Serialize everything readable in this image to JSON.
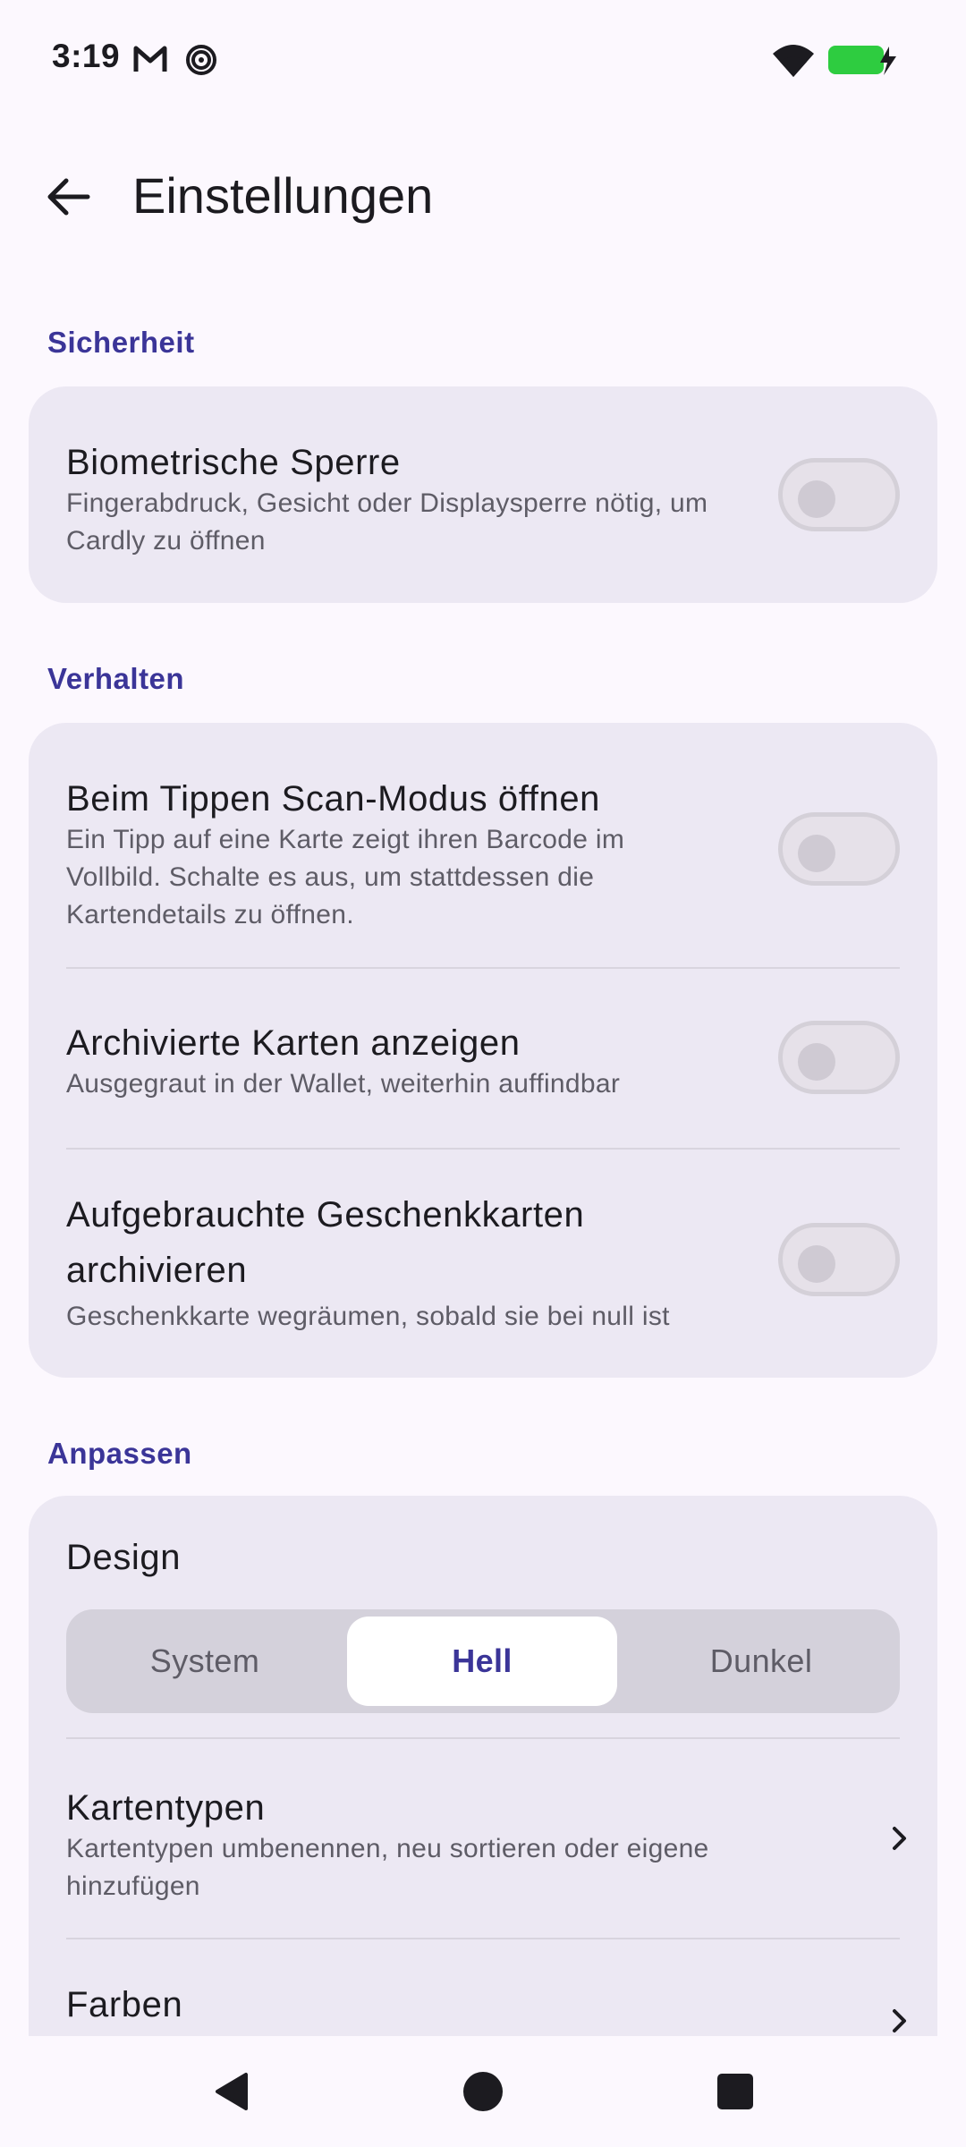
{
  "status_bar": {
    "time": "3:19",
    "left_icons": [
      "gmail-icon",
      "spiral-app-icon"
    ],
    "right_icons": [
      "wifi-icon",
      "battery-charging-icon"
    ],
    "battery_color": "#2ECC40"
  },
  "app_bar": {
    "title": "Einstellungen",
    "back_icon": "arrow-back-icon"
  },
  "sections": {
    "security": {
      "header": "Sicherheit",
      "biometric": {
        "title": "Biometrische Sperre",
        "subtitle_line1": "Fingerabdruck, Gesicht oder Displaysperre nötig, um",
        "subtitle_line2": "Cardly zu öffnen",
        "enabled": false
      }
    },
    "behavior": {
      "header": "Verhalten",
      "scan_mode": {
        "title": "Beim Tippen Scan-Modus öffnen",
        "subtitle_line1": "Ein Tipp auf eine Karte zeigt ihren Barcode im",
        "subtitle_line2": "Vollbild. Schalte es aus, um stattdessen die",
        "subtitle_line3": "Kartendetails zu öffnen.",
        "enabled": false
      },
      "show_archived": {
        "title": "Archivierte Karten anzeigen",
        "subtitle": "Ausgegraut in der Wallet, weiterhin auffindbar",
        "enabled": false
      },
      "archive_giftcards": {
        "title_line1": "Aufgebrauchte Geschenkkarten",
        "title_line2": "archivieren",
        "subtitle": "Geschenkkarte wegräumen, sobald sie bei null ist",
        "enabled": false
      }
    },
    "customize": {
      "header": "Anpassen",
      "design": {
        "title": "Design",
        "options": [
          "System",
          "Hell",
          "Dunkel"
        ],
        "selected": "Hell"
      },
      "card_types": {
        "title": "Kartentypen",
        "subtitle_line1": "Kartentypen umbenennen, neu sortieren oder eigene",
        "subtitle_line2": "hinzufügen",
        "chevron_icon": "chevron-right-icon"
      },
      "colors": {
        "title": "Farben",
        "chevron_icon": "chevron-right-icon"
      }
    }
  },
  "nav_bar": {
    "buttons": [
      "nav-back-icon",
      "nav-home-icon",
      "nav-recents-icon"
    ]
  },
  "colors": {
    "accent": "#3B3598",
    "background": "#FCF8FE",
    "card": "#ECE8F3"
  }
}
